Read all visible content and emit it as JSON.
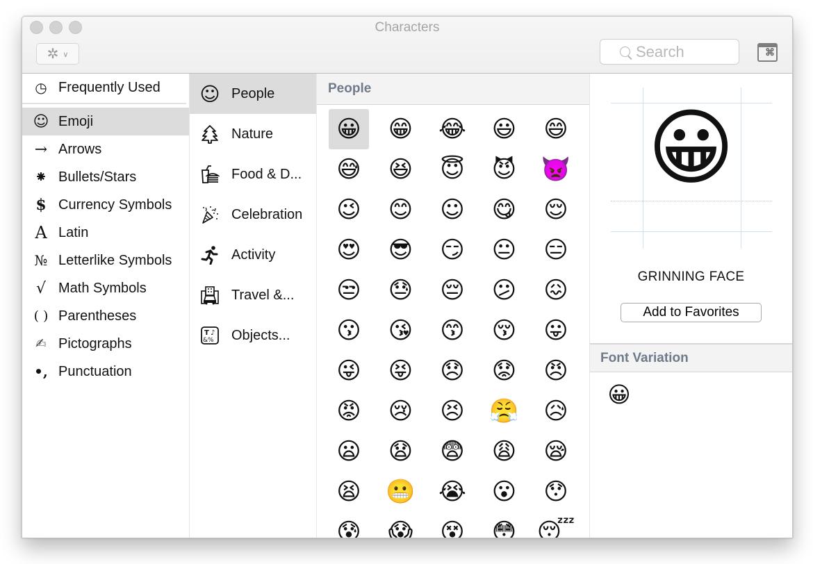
{
  "window": {
    "title": "Characters"
  },
  "toolbar": {
    "gear_icon": "gear-icon",
    "chevron_icon": "chevron-down-icon",
    "search_placeholder": "Search",
    "search_value": "",
    "keyboard_viewer_glyph": "⌘"
  },
  "sidebar": {
    "frequently_used": {
      "icon": "🕘",
      "label": "Frequently Used"
    },
    "items": [
      {
        "icon": "☺",
        "label": "Emoji",
        "selected": true
      },
      {
        "icon": "→",
        "label": "Arrows"
      },
      {
        "icon": "⁕",
        "label": "Bullets/Stars"
      },
      {
        "icon": "$",
        "label": "Currency Symbols"
      },
      {
        "icon": "A",
        "label": "Latin"
      },
      {
        "icon": "№",
        "label": "Letterlike Symbols"
      },
      {
        "icon": "√",
        "label": "Math Symbols"
      },
      {
        "icon": "( )",
        "label": "Parentheses"
      },
      {
        "icon": "✍",
        "label": "Pictographs"
      },
      {
        "icon": "•,",
        "label": "Punctuation"
      }
    ]
  },
  "subcategories": [
    {
      "icon": "☺",
      "label": "People",
      "selected": true
    },
    {
      "icon": "♣",
      "label": "Nature"
    },
    {
      "icon": "🍔",
      "label": "Food & D..."
    },
    {
      "icon": "🎉",
      "label": "Celebration"
    },
    {
      "icon": "🏃",
      "label": "Activity"
    },
    {
      "icon": "🏢",
      "label": "Travel &..."
    },
    {
      "icon": "🔣",
      "label": "Objects..."
    }
  ],
  "grid": {
    "header": "People",
    "emojis": [
      "😀",
      "😁",
      "😂",
      "😃",
      "😄",
      "😅",
      "😆",
      "😇",
      "😈",
      "👿",
      "😉",
      "😊",
      "☺",
      "😋",
      "😌",
      "😍",
      "😎",
      "😏",
      "😐",
      "😑",
      "😒",
      "😓",
      "😔",
      "😕",
      "😖",
      "😗",
      "😘",
      "😙",
      "😚",
      "😛",
      "😜",
      "😝",
      "😞",
      "😟",
      "😠",
      "😡",
      "😢",
      "😣",
      "😤",
      "😥",
      "😦",
      "😧",
      "😨",
      "😩",
      "😪",
      "😫",
      "😬",
      "😭",
      "😮",
      "😯",
      "😰",
      "😱",
      "😵",
      "😳",
      "😴"
    ],
    "selected_index": 0
  },
  "detail": {
    "preview_emoji": "😀",
    "character_name": "GRINNING FACE",
    "add_favorites_label": "Add to Favorites",
    "font_variation_header": "Font Variation",
    "font_variations": [
      "😀"
    ]
  }
}
